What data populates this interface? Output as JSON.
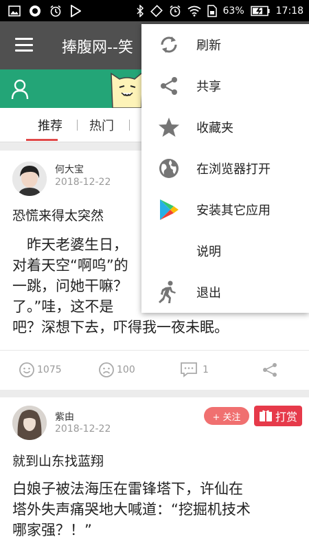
{
  "statusbar": {
    "battery": "63%",
    "time": "17:18",
    "icons": [
      "gallery-icon",
      "record-icon",
      "alarm-timer-icon",
      "play-icon",
      "bluetooth-icon",
      "rotate-icon",
      "alarm-icon",
      "wifi-icon",
      "sim-icon",
      "battery-icon",
      "charging-icon"
    ]
  },
  "appbar": {
    "title": "捧腹网--笑"
  },
  "tabs": [
    "推荐",
    "热门"
  ],
  "posts": [
    {
      "author": "何大宝",
      "date": "2018-12-22",
      "title": "恐慌来得太突然",
      "body_lines": [
        "　昨天老婆生日，",
        "对着天空“啊呜”的",
        "一跳，问她干嘛？",
        "了。”哇，这不是",
        "吧？深想下去，吓得我一夜未眠。"
      ],
      "likes": "1075",
      "dislikes": "100",
      "comments": "1"
    },
    {
      "author": "紫由",
      "date": "2018-12-22",
      "follow_label": "+ 关注",
      "reward_label": "打赏",
      "title": "就到山东找蓝翔",
      "body_lines": [
        "白娘子被法海压在雷锋塔下，许仙在",
        "塔外失声痛哭地大喊道：“挖掘机技术",
        "哪家强？！”"
      ]
    }
  ],
  "menu": {
    "items": [
      {
        "label": "刷新",
        "icon": "refresh-icon"
      },
      {
        "label": "共享",
        "icon": "share-icon"
      },
      {
        "label": "收藏夹",
        "icon": "star-icon"
      },
      {
        "label": "在浏览器打开",
        "icon": "globe-icon"
      },
      {
        "label": "安装其它应用",
        "icon": "play-store-icon"
      },
      {
        "label": "说明",
        "icon": ""
      },
      {
        "label": "退出",
        "icon": "exit-run-icon"
      }
    ]
  },
  "colors": {
    "appbar": "#505050",
    "green_bar": "#23a577",
    "tab_underline": "#e04848",
    "follow": "#f07070",
    "reward": "#e63a4a"
  }
}
